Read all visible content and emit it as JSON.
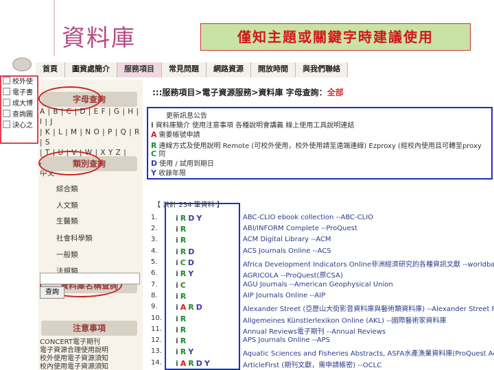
{
  "slide": {
    "title": "資料庫",
    "banner": "僅知主題或關鍵字時建議使用"
  },
  "nav": [
    "首頁",
    "圖資處簡介",
    "服務項目",
    "常見問題",
    "網路資源",
    "開放時間",
    "與我們聯絡"
  ],
  "nav_active": 2,
  "left_pane": [
    "校外使",
    "電子書",
    "成大博",
    "查詢圖",
    "決心之"
  ],
  "sidebar": {
    "letter_section": "字母查詢",
    "letters_line1": "A | B | C | D | E  F | G | H | I | J",
    "letters_line2": "| K | L | M | N  O | P | Q | R | S",
    "letters_line3": "| T | U | V | W | X  Y  Z | ALL |",
    "letters_line4": "中文",
    "category_section": "類別查詢",
    "categories": [
      "綜合類",
      "人文類",
      "生醫類",
      "社會科學類",
      "一般類",
      "法規類"
    ],
    "dbname_section": "資料庫名稱查詢",
    "query_button": "查詢",
    "notice_section": "注意事項",
    "notices": [
      "CONCERT電子期刊",
      "電子資源合理使用說明",
      "校外使用電子資源須知",
      "校內使用電子資源須知",
      "說明會講義"
    ]
  },
  "main": {
    "breadcrumb": ":::服務項目>電子資源服務>資料庫 字母查詢：",
    "breadcrumb_tag": "全部",
    "info_title": "更新訊息公告",
    "info_rows": [
      {
        "icon": "i",
        "text": "資料庫簡介 使用注意事項 各種說明會講義 線上使用工具說明連結"
      },
      {
        "icon": "A",
        "text": "需要帳號申請"
      },
      {
        "icon": "R",
        "text": "連線方式及使用說明 Remote (可校外使用，校外使用請至遠端連線) Ezproxy (經校內使用且可轉至proxy"
      },
      {
        "icon": "C",
        "text": "同"
      },
      {
        "icon": "D",
        "text": "使用 / 試用到期日"
      },
      {
        "icon": "Y",
        "text": "收錄年限"
      }
    ],
    "count_text": "【 共計 234 筆資料 】",
    "databases": [
      {
        "num": "1.",
        "icons": "i R D Y",
        "name": "ABC-CLIO ebook collection --ABC-CLIO"
      },
      {
        "num": "2.",
        "icons": "i R",
        "name": "ABI/INFORM Complete --ProQuest"
      },
      {
        "num": "3.",
        "icons": "i R",
        "name": "ACM Digital Library --ACM"
      },
      {
        "num": "4.",
        "icons": "i R D",
        "name": "ACS Journals Online --ACS"
      },
      {
        "num": "5.",
        "icons": "i C D",
        "name": "Africa Development Indicators Online非洲經濟研究的各種資訊文獻 --worldbank"
      },
      {
        "num": "6.",
        "icons": "i R Y",
        "name": "AGRICOLA --ProQuest(原CSA)"
      },
      {
        "num": "7.",
        "icons": "i C",
        "name": "AGU Journals --American Geophysical Union"
      },
      {
        "num": "8.",
        "icons": "i R",
        "name": "AIP Journals Online --AIP"
      },
      {
        "num": "9.",
        "icons": "i A R D",
        "name": "Alexander Street (亞歷山大街影音資料庫與藝術類資料庫) --Alexander Street Press"
      },
      {
        "num": "10.",
        "icons": "i R",
        "name": "Allgemeines Künstlerlexikon Online (AKL) --國際藝術家資料庫"
      },
      {
        "num": "11.",
        "icons": "i R",
        "name": "Annual Reviews電子期刊 --Annual Reviews"
      },
      {
        "num": "12.",
        "icons": "i R",
        "name": "APS Journals Online --APS"
      },
      {
        "num": "13.",
        "icons": "i R Y",
        "name": "Aquatic Sciences and Fisheries Abstracts, ASFA水產漁業資料庫(ProQuest Acuaf"
      },
      {
        "num": "14.",
        "icons": "i A R D Y",
        "name": "ArticleFirst (期刊文獻，需申請帳密) --OCLC"
      }
    ]
  },
  "colors": {
    "title": "#b34a82",
    "banner_bg": "#c9e3a6",
    "banner_text": "#d01818",
    "highlight_blue": "#1a2bd0",
    "highlight_red": "#d02020"
  }
}
